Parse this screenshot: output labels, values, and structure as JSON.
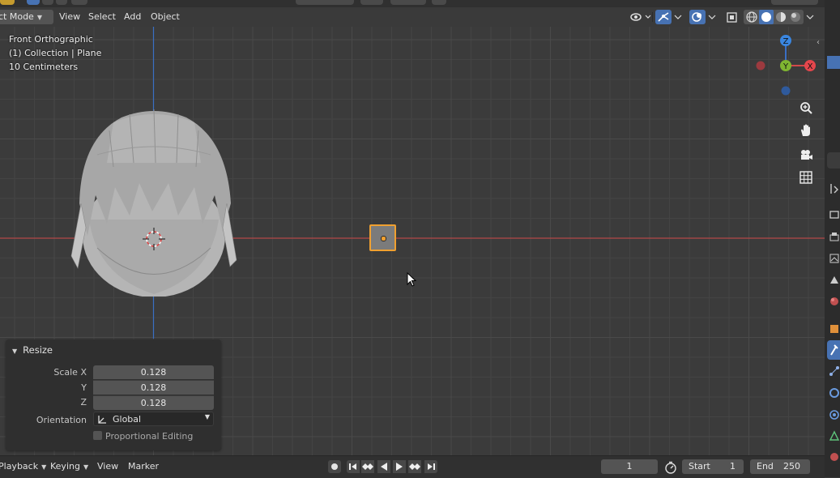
{
  "header": {
    "mode_label": "ct Mode",
    "menus": [
      "View",
      "Select",
      "Add",
      "Object"
    ]
  },
  "viewport": {
    "view_name": "Front Orthographic",
    "collection_info": "(1) Collection | Plane",
    "scale_info": "10 Centimeters"
  },
  "gizmo": {
    "z": "Z",
    "y": "Y",
    "x": "X"
  },
  "resize_panel": {
    "title": "Resize",
    "scale_x_label": "Scale X",
    "scale_y_label": "Y",
    "scale_z_label": "Z",
    "scale_x": "0.128",
    "scale_y": "0.128",
    "scale_z": "0.128",
    "orientation_label": "Orientation",
    "orientation_value": "Global",
    "proportional_label": "Proportional Editing"
  },
  "timeline": {
    "playback_label": "Playback",
    "keying_label": "Keying",
    "view_label": "View",
    "marker_label": "Marker",
    "current_frame": "1",
    "start_label": "Start",
    "start_value": "1",
    "end_label": "End",
    "end_value": "250"
  },
  "colors": {
    "accent_blue": "#4772b3",
    "selection_orange": "#f0a030",
    "x_axis_red": "#d24a4a",
    "z_axis_blue": "#3a6fc4",
    "y_axis_green": "#7fb531"
  },
  "icons": [
    "visibility-icon",
    "gizmo-icon",
    "overlay-icon",
    "xray-icon",
    "shading-wireframe-icon",
    "shading-solid-icon",
    "shading-material-icon",
    "shading-rendered-icon",
    "zoom-icon",
    "hand-pan-icon",
    "camera-icon",
    "grid-perspective-icon",
    "record-icon",
    "jump-start-icon",
    "prev-keyframe-icon",
    "play-reverse-icon",
    "play-icon",
    "next-keyframe-icon",
    "jump-end-icon",
    "stopwatch-icon"
  ]
}
